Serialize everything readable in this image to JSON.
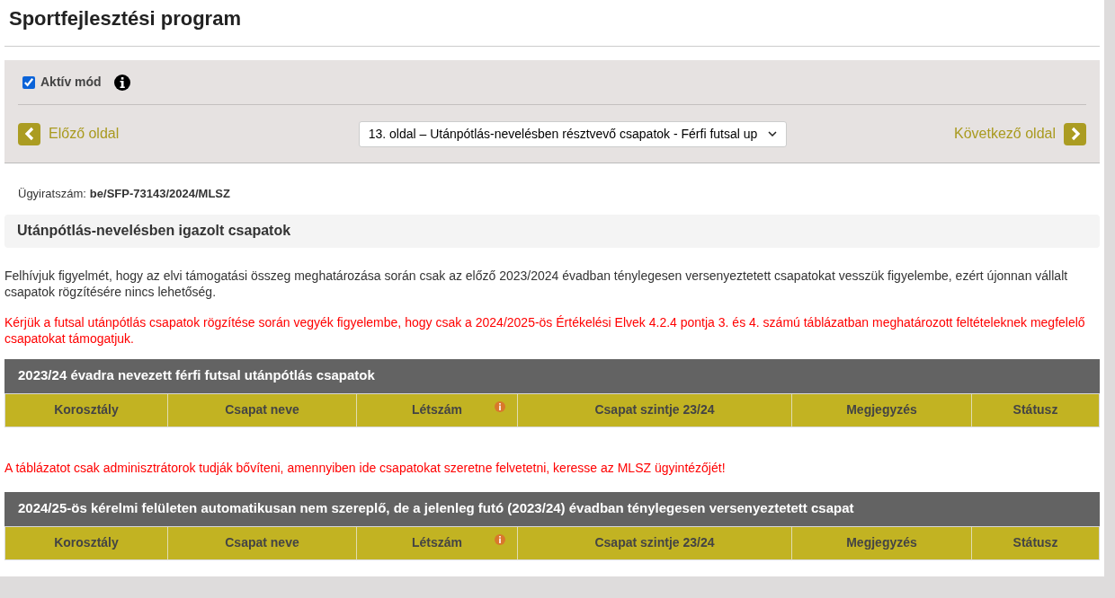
{
  "page_title": "Sportfejlesztési program",
  "toolbar": {
    "active_mode": {
      "label": "Aktív mód",
      "checked": true
    },
    "prev": {
      "label": "Előző oldal"
    },
    "page_select": {
      "value": "13. oldal – Utánpótlás-nevelésben résztvevő csapatok - Férfi futsal up"
    },
    "next": {
      "label": "Következő oldal"
    }
  },
  "case_number": {
    "label": "Ügyiratszám:",
    "value": "be/SFP-73143/2024/MLSZ"
  },
  "section_title": "Utánpótlás-nevelésben igazolt csapatok",
  "notice": "Felhívjuk figyelmét, hogy az elvi támogatási összeg meghatározása során csak az előző 2023/2024 évadban ténylegesen versenyeztetett csapatokat vesszük figyelembe, ezért újonnan vállalt csapatok rögzítésére nincs lehetőség.",
  "warning": "Kérjük a futsal utánpótlás csapatok rögzítése során vegyék figyelembe, hogy csak a 2024/2025-ös Értékelési Elvek 4.2.4 pontja 3. és 4. számú táblázatban meghatározott feltételeknek megfelelő csapatokat támogatjuk.",
  "tables": [
    {
      "title": "2023/24 évadra nevezett férfi futsal utánpótlás csapatok",
      "columns": [
        {
          "label": "Korosztály",
          "info": false
        },
        {
          "label": "Csapat neve",
          "info": false
        },
        {
          "label": "Létszám",
          "info": true
        },
        {
          "label": "Csapat szintje 23/24",
          "info": false
        },
        {
          "label": "Megjegyzés",
          "info": false
        },
        {
          "label": "Státusz",
          "info": false
        }
      ],
      "note": "A táblázatot csak adminisztrátorok tudják bővíteni, amennyiben ide csapatokat szeretne felvetetni, keresse az MLSZ ügyintézőjét!"
    },
    {
      "title": "2024/25-ös kérelmi felületen automatikusan nem szereplő, de a jelenleg futó (2023/24) évadban ténylegesen versenyeztetett csapat",
      "columns": [
        {
          "label": "Korosztály",
          "info": false
        },
        {
          "label": "Csapat neve",
          "info": false
        },
        {
          "label": "Létszám",
          "info": true
        },
        {
          "label": "Csapat szintje 23/24",
          "info": false
        },
        {
          "label": "Megjegyzés",
          "info": false
        },
        {
          "label": "Státusz",
          "info": false
        }
      ]
    }
  ]
}
